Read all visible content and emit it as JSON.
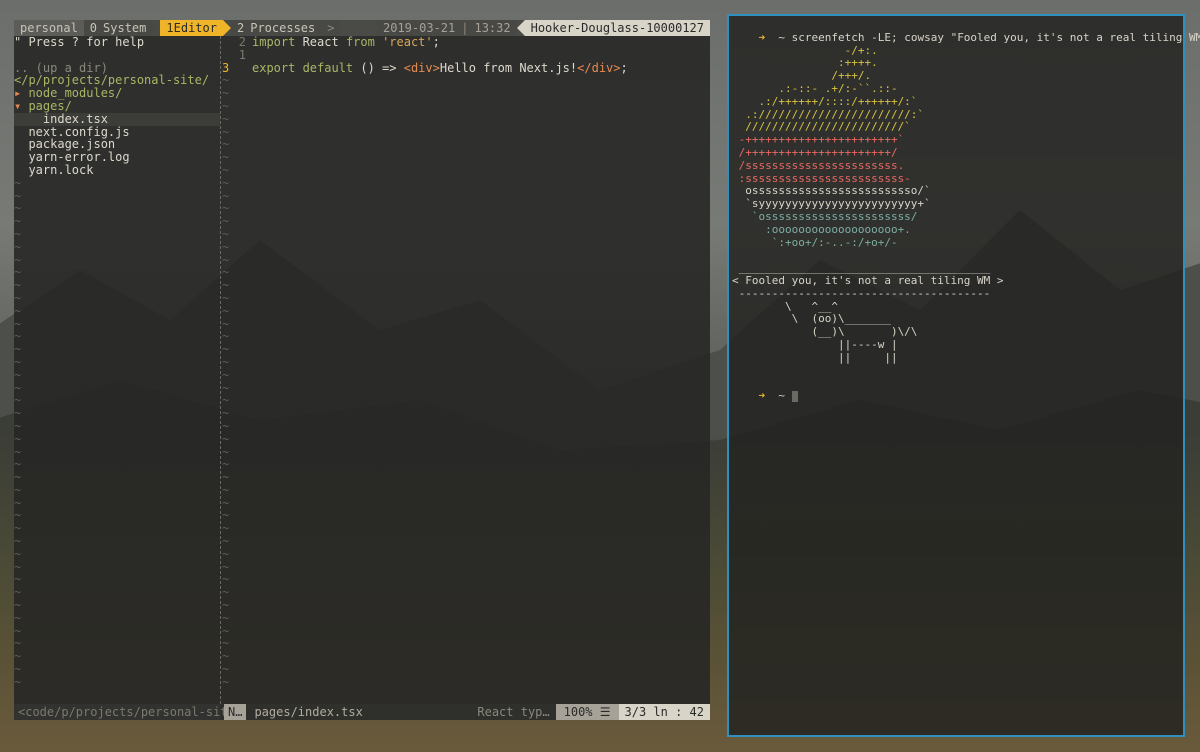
{
  "tmux": {
    "session": "personal",
    "windows": [
      {
        "num": "0",
        "name": "System",
        "active": false
      },
      {
        "num": "1",
        "name": "Editor",
        "active": true
      },
      {
        "num": "2",
        "name": "Processes",
        "active": false
      }
    ],
    "more": ">",
    "date": "2019-03-21",
    "time": "13:32",
    "host": "Hooker-Douglass-10000127"
  },
  "tree": {
    "help": "\" Press ? for help",
    "up_dir": ".. (up a dir)",
    "cwd": "</p/projects/personal-site/",
    "items": [
      {
        "marker": "▸ ",
        "label": "node_modules/",
        "kind": "dir"
      },
      {
        "marker": "▾ ",
        "label": "pages/",
        "kind": "dir"
      },
      {
        "marker": "    ",
        "label": "index.tsx",
        "kind": "file-selected"
      },
      {
        "marker": "  ",
        "label": "next.config.js",
        "kind": "file"
      },
      {
        "marker": "  ",
        "label": "package.json",
        "kind": "file"
      },
      {
        "marker": "  ",
        "label": "yarn-error.log",
        "kind": "file"
      },
      {
        "marker": "  ",
        "label": "yarn.lock",
        "kind": "file"
      }
    ]
  },
  "editor": {
    "lines": [
      {
        "lnr": "2",
        "tokens": [
          [
            "import ",
            "kw"
          ],
          [
            "React ",
            "white"
          ],
          [
            "from ",
            "kw"
          ],
          [
            "'react'",
            "str"
          ],
          [
            ";",
            "white"
          ]
        ]
      },
      {
        "lnr": "1",
        "tokens": []
      },
      {
        "lnr": "3",
        "current": true,
        "tokens": [
          [
            "export default ",
            "kw"
          ],
          [
            "() => ",
            "white"
          ],
          [
            "<div>",
            "tag"
          ],
          [
            "Hello from Next.js!",
            "white"
          ],
          [
            "</div>",
            "tag"
          ],
          [
            ";",
            "white"
          ]
        ]
      }
    ]
  },
  "status": {
    "tree_path": "<code/p/projects/personal-site",
    "mode": "N…",
    "file": "pages/index.tsx",
    "filetype": "React  typ…",
    "percent": "100% ☰",
    "position": "3/3 ln :  42"
  },
  "terminal": {
    "prompt_symbol": "➜",
    "home": "~",
    "command": "screenfetch -LE; cowsay \"Fooled you, it's not a real tiling WM\"",
    "art": [
      [
        "                 -/+:.",
        "y"
      ],
      [
        "                :++++.",
        "y"
      ],
      [
        "               /+++/.",
        "y"
      ],
      [
        "       .:-::- .+/:-``.::-",
        "y"
      ],
      [
        "    .:/++++++/::::/++++++/:`",
        "y"
      ],
      [
        "  .:///////////////////////:`",
        "y"
      ],
      [
        "  ////////////////////////`",
        "y"
      ],
      [
        " -+++++++++++++++++++++++`",
        "r"
      ],
      [
        " /++++++++++++++++++++++/",
        "r"
      ],
      [
        " /sssssssssssssssssssssss.",
        "r"
      ],
      [
        " :ssssssssssssssssssssssss-",
        "r"
      ],
      [
        "  osssssssssssssssssssssssso/`",
        "w"
      ],
      [
        "  `syyyyyyyyyyyyyyyyyyyyyyyy+`",
        "w"
      ],
      [
        "   `ossssssssssssssssssssss/",
        "b"
      ],
      [
        "     :ooooooooooooooooooo+.",
        "b"
      ],
      [
        "      `:+oo+/:-..-:/+o+/-",
        "b"
      ]
    ],
    "cow": [
      " ______________________________________",
      "< Fooled you, it's not a real tiling WM >",
      " --------------------------------------",
      "        \\   ^__^",
      "         \\  (oo)\\_______",
      "            (__)\\       )\\/\\",
      "                ||----w |",
      "                ||     ||"
    ]
  },
  "colors": {
    "accent": "#f0b429",
    "terminal_border": "#2f8fbf"
  }
}
